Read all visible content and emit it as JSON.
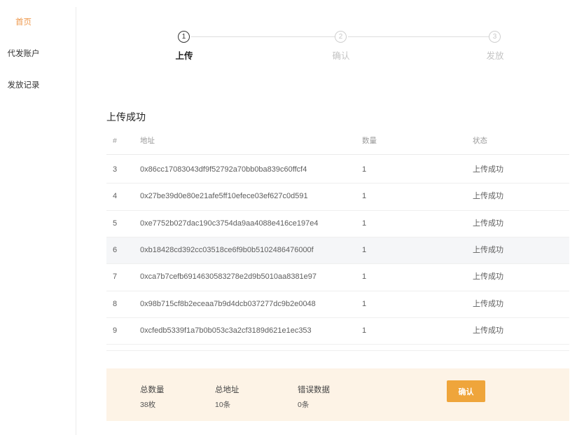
{
  "sidebar": {
    "items": [
      {
        "label": "首页",
        "active": true
      },
      {
        "label": "代发账户",
        "active": false
      },
      {
        "label": "发放记录",
        "active": false
      }
    ]
  },
  "stepper": {
    "steps": [
      {
        "number": "1",
        "label": "上传",
        "active": true
      },
      {
        "number": "2",
        "label": "确认",
        "active": false
      },
      {
        "number": "3",
        "label": "发放",
        "active": false
      }
    ]
  },
  "result": {
    "title": "上传成功",
    "columns": {
      "index": "#",
      "address": "地址",
      "quantity": "数量",
      "status": "状态"
    },
    "rows": [
      {
        "index": "3",
        "address": "0x86cc17083043df9f52792a70bb0ba839c60ffcf4",
        "quantity": "1",
        "status": "上传成功"
      },
      {
        "index": "4",
        "address": "0x27be39d0e80e21afe5ff10efece03ef627c0d591",
        "quantity": "1",
        "status": "上传成功"
      },
      {
        "index": "5",
        "address": "0xe7752b027dac190c3754da9aa4088e416ce197e4",
        "quantity": "1",
        "status": "上传成功"
      },
      {
        "index": "6",
        "address": "0xb18428cd392cc03518ce6f9b0b5102486476000f",
        "quantity": "1",
        "status": "上传成功",
        "highlighted": true
      },
      {
        "index": "7",
        "address": "0xca7b7cefb6914630583278e2d9b5010aa8381e97",
        "quantity": "1",
        "status": "上传成功"
      },
      {
        "index": "8",
        "address": "0x98b715cf8b2eceaa7b9d4dcb037277dc9b2e0048",
        "quantity": "1",
        "status": "上传成功"
      },
      {
        "index": "9",
        "address": "0xcfedb5339f1a7b0b053c3a2cf3189d621e1ec353",
        "quantity": "1",
        "status": "上传成功"
      }
    ]
  },
  "summary": {
    "total_quantity": {
      "label": "总数量",
      "value": "38枚"
    },
    "total_addresses": {
      "label": "总地址",
      "value": "10条"
    },
    "error_records": {
      "label": "错误数据",
      "value": "0条"
    },
    "confirm_label": "确认"
  },
  "colors": {
    "accent": "#efa53b",
    "nav_active": "#ef9a4f",
    "summary_bg": "#fdf3e6",
    "hover_row": "#f5f6f8"
  }
}
